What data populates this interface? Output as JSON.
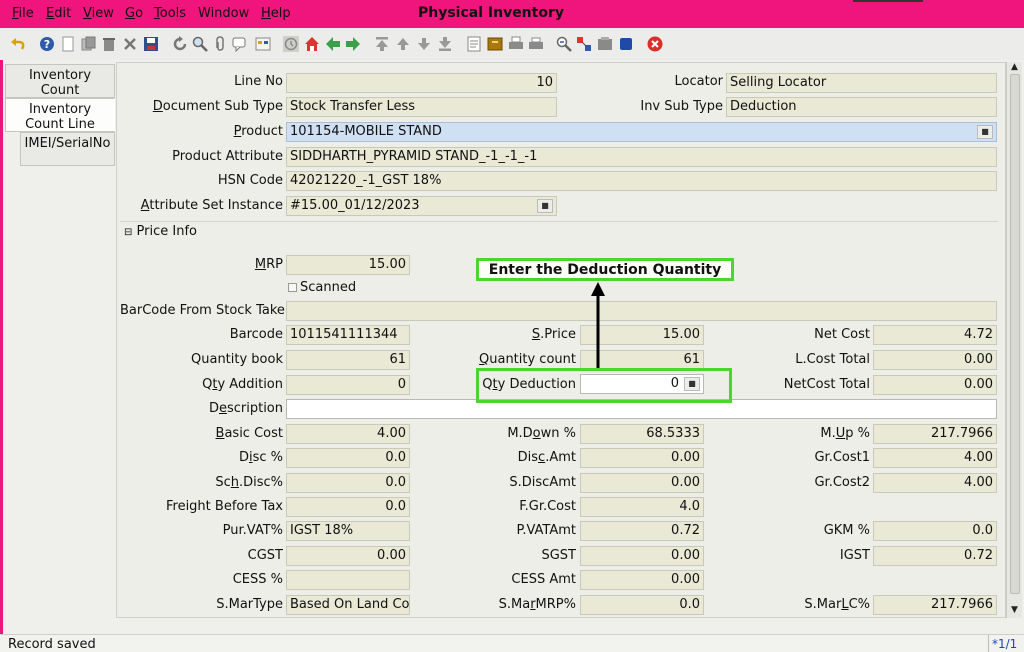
{
  "menubar": {
    "items": [
      {
        "prefix": "",
        "mnemonic": "F",
        "rest": "ile"
      },
      {
        "prefix": "",
        "mnemonic": "E",
        "rest": "dit"
      },
      {
        "prefix": "",
        "mnemonic": "V",
        "rest": "iew"
      },
      {
        "prefix": "",
        "mnemonic": "G",
        "rest": "o"
      },
      {
        "prefix": "",
        "mnemonic": "T",
        "rest": "ools"
      },
      {
        "prefix": "Window",
        "mnemonic": "",
        "rest": ""
      },
      {
        "prefix": "",
        "mnemonic": "H",
        "rest": "elp"
      }
    ],
    "title": "Physical Inventory",
    "accent_color": "#f0157c"
  },
  "toolbar": {
    "icons": [
      "undo-icon",
      "help-icon",
      "new-icon",
      "copy-icon",
      "delete-icon",
      "delete-selection-icon",
      "save-icon",
      "refresh-icon",
      "find-icon",
      "attachment-icon",
      "chat-icon",
      "multi-view-icon",
      "history-icon",
      "home-icon",
      "back-icon",
      "forward-icon",
      "first-record-icon",
      "previous-record-icon",
      "next-record-icon",
      "last-record-icon",
      "report-icon",
      "archive-icon",
      "print-icon",
      "print-preview-icon",
      "zoom-across-icon",
      "request-icon",
      "product-info-icon",
      "process-icon",
      "exit-icon"
    ]
  },
  "tabs": [
    {
      "label1": "Inventory",
      "label2": "Count",
      "active": false
    },
    {
      "label1": "Inventory",
      "label2": "Count Line",
      "active": true
    },
    {
      "label1": "IMEI/SerialNo",
      "label2": "",
      "active": false
    }
  ],
  "form": {
    "line_no": {
      "label": "Line No",
      "value": "10"
    },
    "locator": {
      "label": "Locator",
      "value": "Selling Locator"
    },
    "doc_sub_type": {
      "label_m": "D",
      "label_r": "ocument Sub Type",
      "value": "Stock Transfer Less"
    },
    "inv_sub_type": {
      "label": "Inv Sub Type",
      "value": "Deduction"
    },
    "product": {
      "label_m": "P",
      "label_r": "roduct",
      "value": "101154-MOBILE STAND"
    },
    "product_attribute": {
      "label": "Product Attribute",
      "value": "SIDDHARTH_PYRAMID STAND_-1_-1_-1"
    },
    "hsn_code": {
      "label": "HSN Code",
      "value": "42021220_-1_GST 18%"
    },
    "attribute_set_instance": {
      "label_m": "A",
      "label_r": "ttribute Set Instance",
      "value": "#15.00_01/12/2023"
    },
    "price_info_section": "Price Info",
    "mrp": {
      "label_m": "M",
      "label_r": "RP",
      "value": "15.00"
    },
    "scanned": {
      "label": "Scanned",
      "checked": false
    },
    "barcode_from_stock_take": {
      "label": "BarCode From Stock Take",
      "value": ""
    },
    "barcode": {
      "label": "Barcode",
      "value": "1011541111344"
    },
    "s_price": {
      "label_m": "S",
      "label_r": ".Price",
      "value": "15.00"
    },
    "net_cost": {
      "label": "Net Cost",
      "value": "4.72"
    },
    "quantity_book": {
      "label": "Quantity book",
      "value": "61"
    },
    "quantity_count": {
      "label_m": "Q",
      "label_r": "uantity count",
      "value": "61"
    },
    "l_cost_total": {
      "label": "L.Cost Total",
      "value": "0.00"
    },
    "qty_addition": {
      "label_a": "Q",
      "label_m": "t",
      "label_r": "y Addition",
      "value": "0"
    },
    "qty_deduction": {
      "label_a": "Q",
      "label_m": "t",
      "label_r": "y Deduction",
      "value": "0"
    },
    "netcost_total": {
      "label": "NetCost Total",
      "value": "0.00"
    },
    "description": {
      "label_a": "D",
      "label_m": "e",
      "label_r": "scription",
      "value": ""
    },
    "basic_cost": {
      "label_m": "B",
      "label_r": "asic Cost",
      "value": "4.00"
    },
    "m_down": {
      "label_a": "M.D",
      "label_m": "o",
      "label_r": "wn %",
      "value": "68.5333"
    },
    "m_up": {
      "label_a": "M.",
      "label_m": "U",
      "label_r": "p %",
      "value": "217.7966"
    },
    "disc_pct": {
      "label_a": "D",
      "label_m": "i",
      "label_r": "sc %",
      "value": "0.0"
    },
    "disc_amt": {
      "label_a": "Dis",
      "label_m": "c",
      "label_r": ".Amt",
      "value": "0.00"
    },
    "gr_cost1": {
      "label": "Gr.Cost1",
      "value": "4.00"
    },
    "sch_disc": {
      "label_a": "Sc",
      "label_m": "h",
      "label_r": ".Disc%",
      "value": "0.0"
    },
    "s_disc_amt": {
      "label": "S.DiscAmt",
      "value": "0.00"
    },
    "gr_cost2": {
      "label": "Gr.Cost2",
      "value": "4.00"
    },
    "freight_before_tax": {
      "label": "Freight Before Tax",
      "value": "0.0"
    },
    "f_gr_cost": {
      "label": "F.Gr.Cost",
      "value": "4.0"
    },
    "pur_vat": {
      "label": "Pur.VAT%",
      "value": "IGST 18%"
    },
    "p_vat_amt": {
      "label": "P.VATAmt",
      "value": "0.72"
    },
    "gkm": {
      "label": "GKM %",
      "value": "0.0"
    },
    "cgst": {
      "label": "CGST",
      "value": "0.00"
    },
    "sgst": {
      "label": "SGST",
      "value": "0.00"
    },
    "igst": {
      "label": "IGST",
      "value": "0.72"
    },
    "cess_pct": {
      "label": "CESS %",
      "value": ""
    },
    "cess_amt": {
      "label": "CESS Amt",
      "value": "0.00"
    },
    "s_mar_type": {
      "label": "S.MarType",
      "value": "Based On Land Cost"
    },
    "s_mar_mrp": {
      "label_a": "S.Ma",
      "label_m": "r",
      "label_r": "MRP%",
      "value": "0.0"
    },
    "s_mar_lc": {
      "label_a": "S.Mar",
      "label_m": "L",
      "label_r": "C%",
      "value": "217.7966"
    }
  },
  "annotation": {
    "text": "Enter the Deduction Quantity",
    "color": "#4cd52e"
  },
  "status": {
    "message": "Record saved",
    "page": "*1/1"
  }
}
